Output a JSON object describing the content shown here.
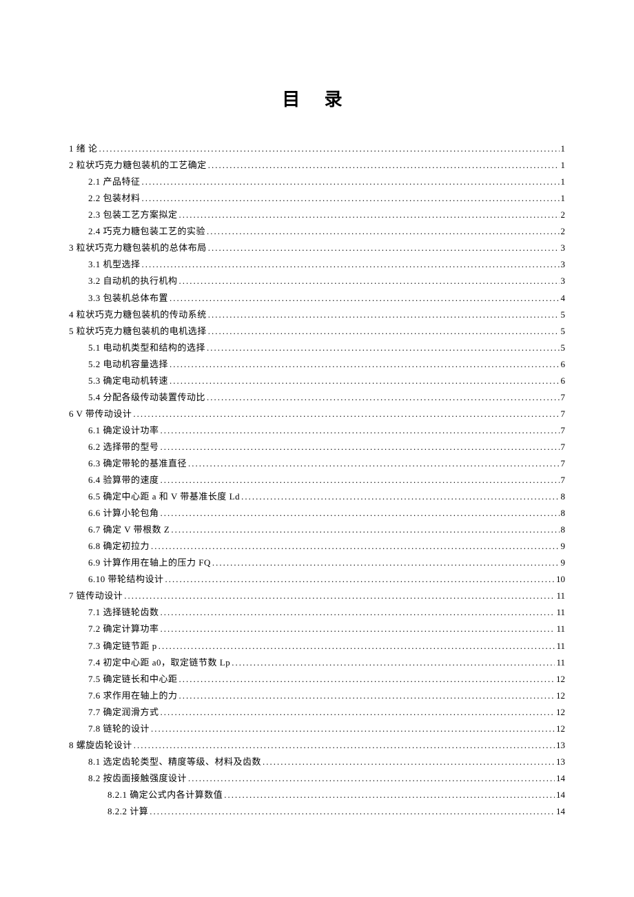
{
  "title": "目 录",
  "toc": [
    {
      "level": 0,
      "label": "1 绪   论",
      "page": "1"
    },
    {
      "level": 0,
      "label": "2 粒状巧克力糖包装机的工艺确定",
      "page": "1"
    },
    {
      "level": 1,
      "label": "2.1 产品特征",
      "page": "1"
    },
    {
      "level": 1,
      "label": "2.2 包装材料",
      "page": "1"
    },
    {
      "level": 1,
      "label": "2.3 包装工艺方案拟定",
      "page": "2"
    },
    {
      "level": 1,
      "label": "2.4 巧克力糖包装工艺的实验",
      "page": "2"
    },
    {
      "level": 0,
      "label": "3 粒状巧克力糖包装机的总体布局",
      "page": "3"
    },
    {
      "level": 1,
      "label": "3.1 机型选择",
      "page": "3"
    },
    {
      "level": 1,
      "label": "3.2 自动机的执行机构",
      "page": "3"
    },
    {
      "level": 1,
      "label": "3.3 包装机总体布置",
      "page": "4"
    },
    {
      "level": 0,
      "label": "4 粒状巧克力糖包装机的传动系统",
      "page": "5"
    },
    {
      "level": 0,
      "label": "5 粒状巧克力糖包装机的电机选择",
      "page": "5"
    },
    {
      "level": 1,
      "label": "5.1 电动机类型和结构的选择",
      "page": "5"
    },
    {
      "level": 1,
      "label": "5.2 电动机容量选择",
      "page": "6"
    },
    {
      "level": 1,
      "label": "5.3 确定电动机转速",
      "page": "6"
    },
    {
      "level": 1,
      "label": "5.4 分配各级传动装置传动比",
      "page": "7"
    },
    {
      "level": 0,
      "label": "6 V 带传动设计",
      "page": "7"
    },
    {
      "level": 1,
      "label": "6.1 确定设计功率",
      "page": "7"
    },
    {
      "level": 1,
      "label": "6.2 选择带的型号",
      "page": "7"
    },
    {
      "level": 1,
      "label": "6.3 确定带轮的基准直径",
      "page": "7"
    },
    {
      "level": 1,
      "label": "6.4 验算带的速度",
      "page": "7"
    },
    {
      "level": 1,
      "label": "6.5 确定中心距 a 和 V 带基准长度 Ld",
      "page": "8"
    },
    {
      "level": 1,
      "label": "6.6 计算小轮包角",
      "page": "8"
    },
    {
      "level": 1,
      "label": "6.7 确定 V 带根数 Z",
      "page": "8"
    },
    {
      "level": 1,
      "label": "6.8 确定初拉力",
      "page": "9"
    },
    {
      "level": 1,
      "label": "6.9 计算作用在轴上的压力 FQ",
      "page": "9"
    },
    {
      "level": 1,
      "label": "6.10 带轮结构设计",
      "page": "10"
    },
    {
      "level": 0,
      "label": "7 链传动设计",
      "page": "11"
    },
    {
      "level": 1,
      "label": "7.1 选择链轮齿数",
      "page": "11"
    },
    {
      "level": 1,
      "label": "7.2 确定计算功率",
      "page": "11"
    },
    {
      "level": 1,
      "label": "7.3 确定链节距 p",
      "page": "11"
    },
    {
      "level": 1,
      "label": "7.4 初定中心距 a0，取定链节数 Lp",
      "page": "11"
    },
    {
      "level": 1,
      "label": "7.5 确定链长和中心距",
      "page": "12"
    },
    {
      "level": 1,
      "label": "7.6 求作用在轴上的力",
      "page": "12"
    },
    {
      "level": 1,
      "label": "7.7 确定润滑方式",
      "page": "12"
    },
    {
      "level": 1,
      "label": "7.8 链轮的设计",
      "page": "12"
    },
    {
      "level": 0,
      "label": "8 螺旋齿轮设计",
      "page": "13"
    },
    {
      "level": 1,
      "label": "8.1 选定齿轮类型、精度等级、材料及齿数",
      "page": "13"
    },
    {
      "level": 1,
      "label": "8.2 按齿面接触强度设计",
      "page": "14"
    },
    {
      "level": 2,
      "label": "8.2.1 确定公式内各计算数值",
      "page": "14"
    },
    {
      "level": 2,
      "label": "8.2.2 计算",
      "page": "14"
    }
  ]
}
